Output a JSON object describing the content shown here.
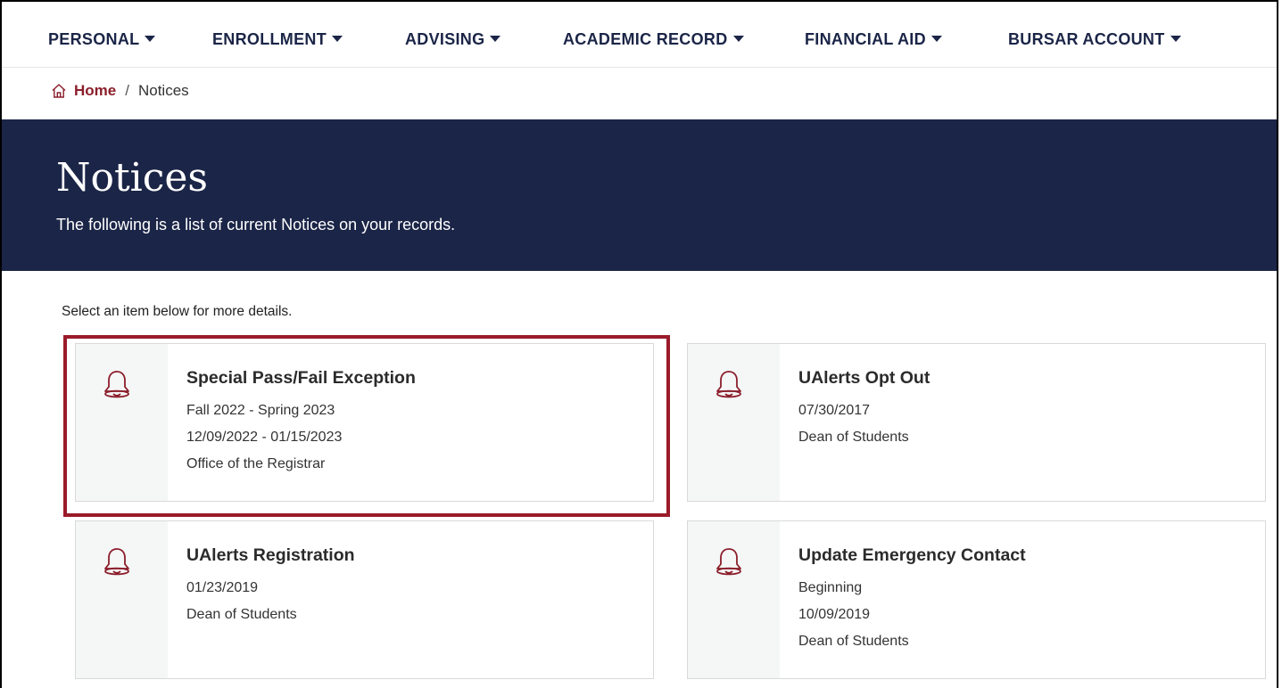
{
  "nav": {
    "items": [
      {
        "label": "PERSONAL"
      },
      {
        "label": "ENROLLMENT"
      },
      {
        "label": "ADVISING"
      },
      {
        "label": "ACADEMIC RECORD"
      },
      {
        "label": "FINANCIAL AID"
      },
      {
        "label": "BURSAR ACCOUNT"
      }
    ]
  },
  "breadcrumb": {
    "home": "Home",
    "separator": "/",
    "current": "Notices"
  },
  "banner": {
    "title": "Notices",
    "subtitle": "The following is a list of current Notices on your records."
  },
  "main": {
    "instructions": "Select an item below for more details.",
    "cards": [
      {
        "title": "Special Pass/Fail Exception",
        "lines": [
          "Fall 2022 - Spring 2023",
          "12/09/2022 - 01/15/2023",
          "Office of the Registrar"
        ],
        "highlighted": true
      },
      {
        "title": "UAlerts Opt Out",
        "lines": [
          "07/30/2017",
          "Dean of Students"
        ]
      },
      {
        "title": "UAlerts Registration",
        "lines": [
          "01/23/2019",
          "Dean of Students"
        ]
      },
      {
        "title": "Update Emergency Contact",
        "lines": [
          "Beginning",
          "10/09/2019",
          "Dean of Students"
        ]
      }
    ]
  },
  "colors": {
    "navy": "#1b2547",
    "maroon": "#8b1e2b",
    "highlight": "#9b1b2a",
    "card_icon_bg": "#f5f6f6"
  },
  "icons": {
    "card": "bell-icon",
    "breadcrumb": "home-icon",
    "nav": "caret-down-icon"
  }
}
